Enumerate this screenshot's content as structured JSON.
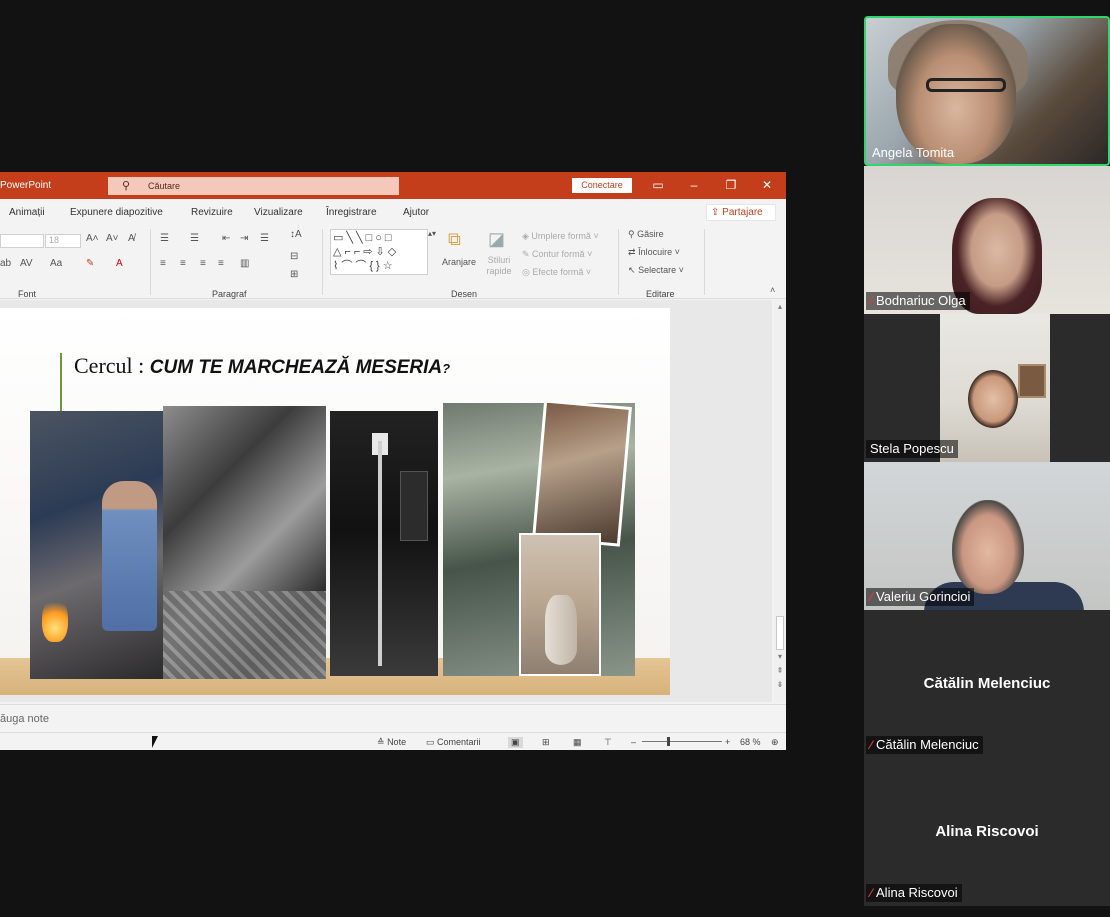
{
  "powerpoint": {
    "app_name": "PowerPoint",
    "search_placeholder": "Căutare",
    "connect_label": "Conectare",
    "tabs": [
      "Animații",
      "Expunere diapozitive",
      "Revizuire",
      "Vizualizare",
      "Înregistrare",
      "Ajutor"
    ],
    "share_label": "Partajare",
    "ribbon": {
      "font_size": "18",
      "groups": [
        "Font",
        "Paragraf",
        "Desen",
        "Editare"
      ],
      "arrange_label": "Aranjare",
      "quick_styles_label": "Stiluri rapide",
      "shape_fill": "Umplere formă",
      "shape_outline": "Contur formă",
      "shape_effects": "Efecte formă",
      "find": "Găsire",
      "replace": "Înlocuire",
      "select": "Selectare"
    },
    "slide": {
      "title_plain": "Cercul : ",
      "title_emphasis": "CUM TE MARCHEAZĂ MESERIA",
      "title_question": "?"
    },
    "notes_placeholder": "ăuga note",
    "status": {
      "notes": "Note",
      "comments": "Comentarii",
      "zoom_minus": "–",
      "zoom_plus": "+",
      "zoom": "68 %"
    }
  },
  "participants": [
    {
      "name": "Angela Tomita",
      "muted": false,
      "video": true,
      "speaking": true
    },
    {
      "name": "Bodnariuc Olga",
      "muted": true,
      "video": true
    },
    {
      "name": "Stela Popescu",
      "muted": false,
      "video": true
    },
    {
      "name": "Valeriu Gorincioi",
      "muted": true,
      "video": true
    },
    {
      "name": "Cătălin Melenciuc",
      "display": "Cătălin Melenciuc",
      "muted": true,
      "video": false
    },
    {
      "name": "Alina Riscovoi",
      "display": "Alina Riscovoi",
      "muted": true,
      "video": false
    }
  ],
  "colors": {
    "ppt_accent": "#c43e1c",
    "speaking_border": "#2fd66b",
    "muted_icon": "#e53935"
  }
}
